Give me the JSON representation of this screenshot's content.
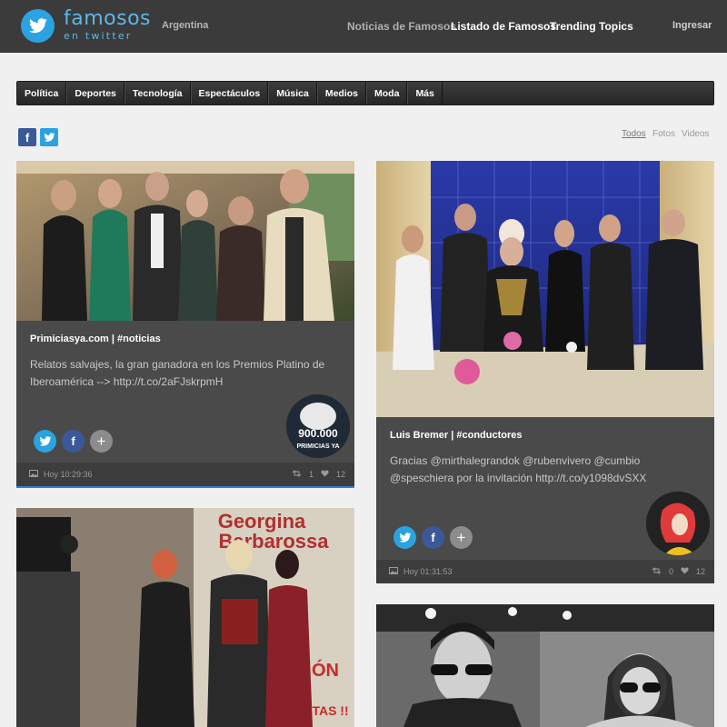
{
  "header": {
    "logo_main": "famosos",
    "logo_sub": "en twitter",
    "country": "Argentina",
    "nav": [
      "Noticias de Famosos",
      "Listado de Famosos",
      "Trending Topics"
    ],
    "login": "Ingresar"
  },
  "categories": [
    "Política",
    "Deportes",
    "Tecnología",
    "Espectáculos",
    "Música",
    "Medios",
    "Moda",
    "Más"
  ],
  "filters": [
    "Todos",
    "Fotos",
    "Videos"
  ],
  "cards": [
    {
      "author": "Primiciasya.com | #noticias",
      "tweet": "Relatos salvajes, la gran ganadora en los Premios Platino de Iberoamérica --> http://t.co/2aFJskrpmH",
      "time": "Hoy 10:29:36",
      "retweets": "1",
      "favorites": "12",
      "avatar_text": "900.000",
      "avatar_sub": "PRIMICIAS YA"
    },
    {
      "author": "Luis Bremer | #conductores",
      "tweet": "Gracias @mirthalegrandok @rubenvivero @cumbio @speschiera por la invitación http://t.co/y1098dvSXX",
      "time": "Hoy 01:31:53",
      "retweets": "0",
      "favorites": "12"
    },
    {
      "sign_line1": "Georgina",
      "sign_line2": "Barbarossa",
      "sign_text": "ÓN",
      "sign_text2": "LOJITAS !!"
    }
  ],
  "colors": {
    "header_bg": "#3b3b3b",
    "twitter_blue": "#2aa3e0",
    "facebook_blue": "#3b5998",
    "card_bg": "#4a4a4a",
    "card_blue_border": "#3a7bd5",
    "card_red_border": "#d23a3a"
  }
}
